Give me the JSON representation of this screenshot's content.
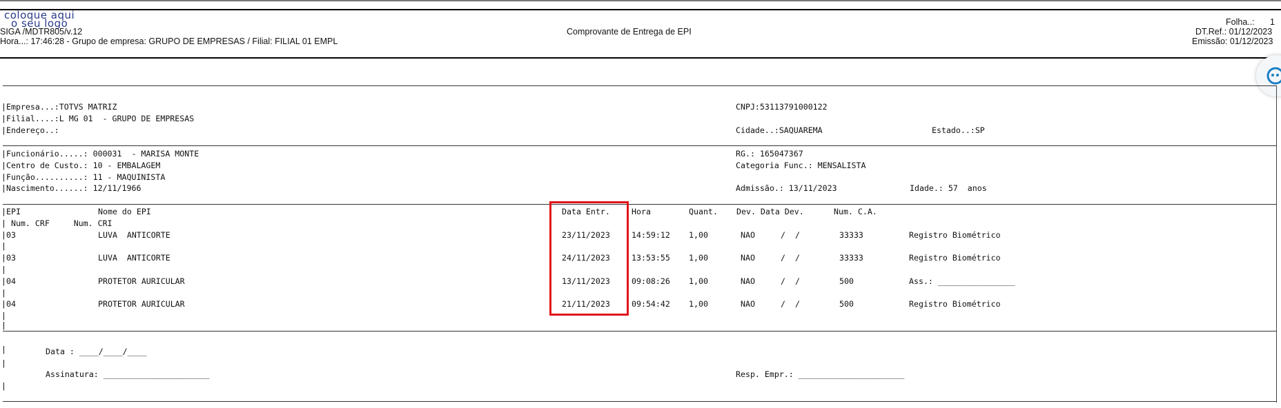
{
  "header": {
    "logo_line1": "coloque aqui",
    "logo_line2": "o seu logo",
    "program": "SIGA /MDTR805/v.12",
    "time_line": "Hora...: 17:46:28 - Grupo de empresa: GRUPO DE EMPRESAS / Filial: FILIAL 01 EMPL",
    "title": "Comprovante de Entrega de EPI",
    "folha_label": "Folha..:",
    "folha_value": "1",
    "dtref": "DT.Ref.: 01/12/2023",
    "emissao": "Emissão: 01/12/2023"
  },
  "company": {
    "empresa": "|Empresa...:TOTVS MATRIZ",
    "cnpj": "CNPJ:53113791000122",
    "filial": "|Filial....:L MG 01  - GRUPO DE EMPRESAS",
    "endereco": "|Endereço..:",
    "cidade": "Cidade..:SAQUAREMA",
    "estado": "Estado..:SP"
  },
  "employee": {
    "funcionario": "|Funcionário.....: 000031  - MARISA MONTE",
    "rg": "RG.: 165047367",
    "centro": "|Centro de Custo.: 10 - EMBALAGEM",
    "categoria": "Categoria Func.: MENSALISTA",
    "funcao": "|Função..........: 11 - MAQUINISTA",
    "nascimento": "|Nascimento......: 12/11/1966",
    "admissao": "Admissão.: 13/11/2023",
    "idade": "Idade.: 57  anos"
  },
  "table": {
    "headers": {
      "epi": "|EPI",
      "nome": "Nome do EPI",
      "data": "Data Entr.",
      "hora": "Hora",
      "quant": "Quant.",
      "dev": "Dev. Data Dev.",
      "ca": "Num. C.A."
    },
    "subheader": "| Num. CRF     Num. CRI",
    "rows": [
      {
        "epi": "|03",
        "nome": "LUVA  ANTICORTE",
        "data": "23/11/2023",
        "hora": "14:59:12",
        "quant": "1,00",
        "dev": "NAO",
        "datadev": "/  /",
        "ca": "33333",
        "ass": "Registro Biométrico"
      },
      {
        "epi": "|03",
        "nome": "LUVA  ANTICORTE",
        "data": "24/11/2023",
        "hora": "13:53:55",
        "quant": "1,00",
        "dev": "NAO",
        "datadev": "/  /",
        "ca": "33333",
        "ass": "Registro Biométrico"
      },
      {
        "epi": "|04",
        "nome": "PROTETOR AURICULAR",
        "data": "13/11/2023",
        "hora": "09:08:26",
        "quant": "1,00",
        "dev": "NAO",
        "datadev": "/  /",
        "ca": "500",
        "ass": "Ass.: ________________"
      },
      {
        "epi": "|04",
        "nome": "PROTETOR AURICULAR",
        "data": "21/11/2023",
        "hora": "09:54:42",
        "quant": "1,00",
        "dev": "NAO",
        "datadev": "/  /",
        "ca": "500",
        "ass": "Registro Biométrico"
      }
    ]
  },
  "footer": {
    "data_label": "Data : ____/____/____",
    "assinatura_label": "Assinatura: ______________________",
    "resp_label": "Resp. Empr.: ______________________"
  },
  "colors": {
    "highlight": "#e0141b"
  },
  "icons": {
    "side_widget": "chat-assistant-icon"
  }
}
